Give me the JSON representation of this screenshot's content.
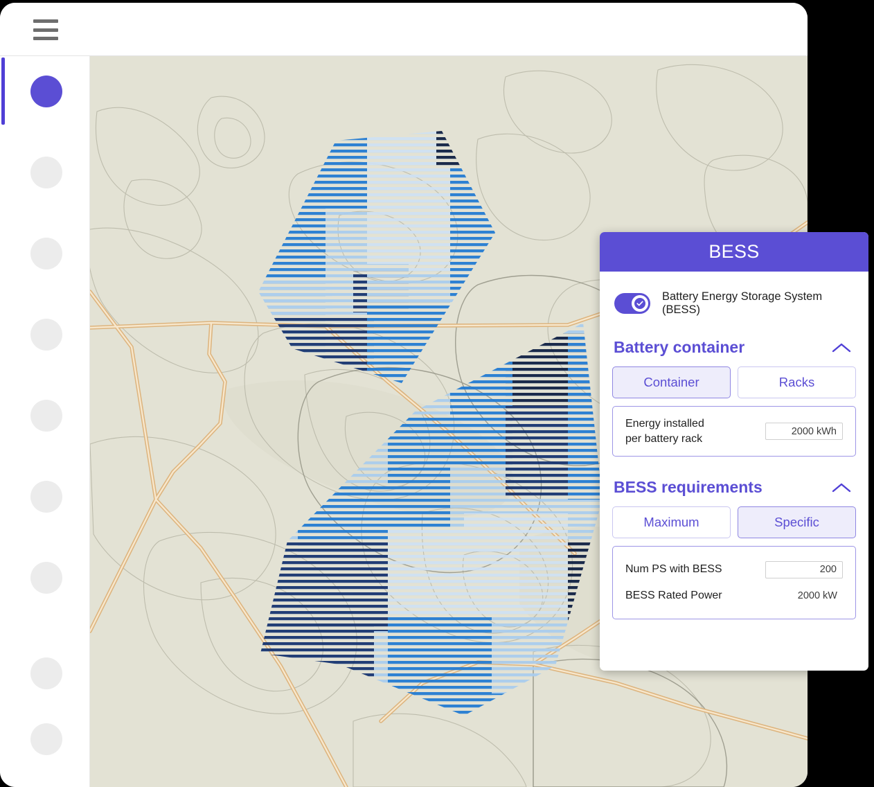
{
  "window": {
    "menu_icon": "hamburger-menu-icon"
  },
  "sidebar": {
    "items": [
      {
        "icon": "nav-circle-icon",
        "active": true
      },
      {
        "icon": "nav-circle-icon",
        "active": false
      },
      {
        "icon": "nav-circle-icon",
        "active": false
      },
      {
        "icon": "nav-circle-icon",
        "active": false
      },
      {
        "icon": "nav-circle-icon",
        "active": false
      },
      {
        "icon": "nav-circle-icon",
        "active": false
      },
      {
        "icon": "nav-circle-icon",
        "active": false
      },
      {
        "icon": "nav-circle-icon",
        "active": false
      },
      {
        "icon": "nav-circle-icon",
        "active": false
      }
    ]
  },
  "map": {
    "background_color": "#e3e2d4",
    "road_color": "#e6b470",
    "contour_color": "#b4b3a4",
    "hatch_colors": {
      "light": "#a9cdee",
      "pale": "#c3dcf3",
      "medium": "#1f79d2",
      "dark": "#12306e",
      "darkest": "#0a1d44"
    }
  },
  "panel": {
    "title": "BESS",
    "toggle": {
      "label": "Battery Energy Storage System (BESS)",
      "checked": true
    },
    "sections": [
      {
        "title": "Battery container",
        "collapse_icon": "chevron-up-icon",
        "segments": [
          {
            "label": "Container",
            "selected": true
          },
          {
            "label": "Racks",
            "selected": false
          }
        ],
        "fields": [
          {
            "label": "Energy installed\nper battery rack",
            "value": "2000 kWh",
            "editable": true
          }
        ]
      },
      {
        "title": "BESS requirements",
        "collapse_icon": "chevron-up-icon",
        "segments": [
          {
            "label": "Maximum",
            "selected": false
          },
          {
            "label": "Specific",
            "selected": true
          }
        ],
        "fields": [
          {
            "label": "Num PS with BESS",
            "value": "200",
            "editable": true
          },
          {
            "label": "BESS Rated Power",
            "value": "2000 kW",
            "editable": false
          }
        ]
      }
    ]
  },
  "colors": {
    "brand_purple": "#5b4ed4",
    "selected_fill": "#eeedfb",
    "panel_border": "#9d95e6"
  }
}
